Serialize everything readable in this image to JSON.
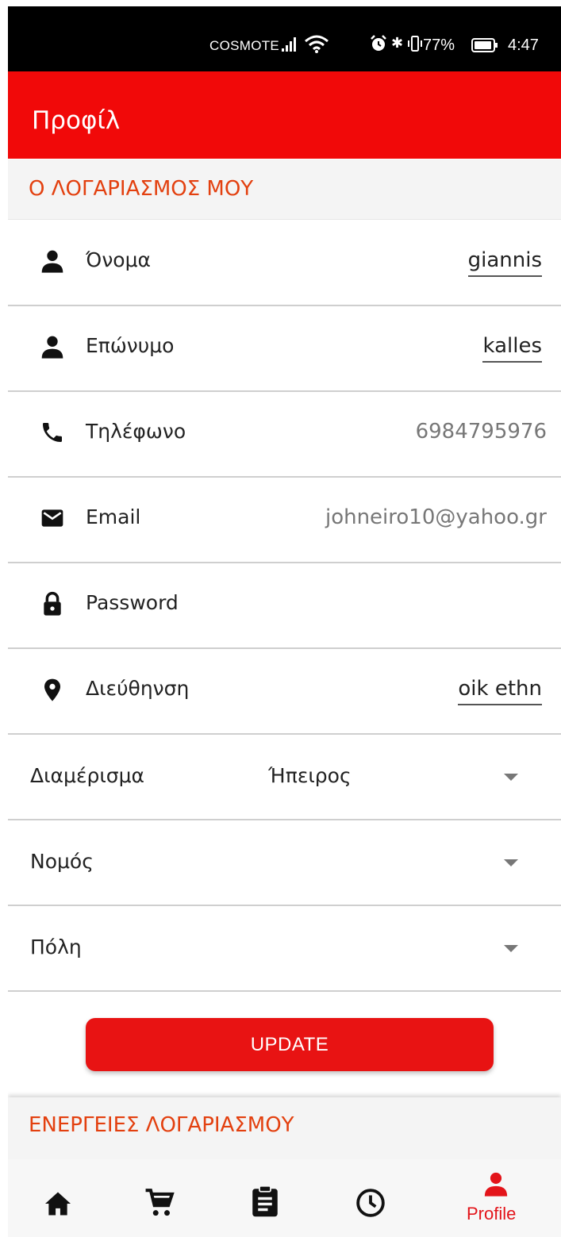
{
  "status_bar": {
    "carrier": "COSMOTE",
    "battery_percent": "77%",
    "time": "4:47",
    "icons": [
      "signal-icon",
      "wifi-icon",
      "alarm-icon",
      "bluetooth-icon",
      "vibrate-icon",
      "battery-icon"
    ]
  },
  "app_bar": {
    "title": "Προφίλ"
  },
  "colors": {
    "primary": "#f10909",
    "accent_text": "#e3400f",
    "button": "#e81313",
    "active_nav": "#e3141a"
  },
  "account_section": {
    "title": "Ο ΛΟΓΑΡΙΑΣΜΟΣ ΜΟΥ",
    "fields": [
      {
        "icon": "person-icon",
        "label": "Όνομα",
        "value": "giannis"
      },
      {
        "icon": "person-icon",
        "label": "Επώνυμο",
        "value": "kalles"
      },
      {
        "icon": "phone-icon",
        "label": "Τηλέφωνο",
        "value": "6984795976"
      },
      {
        "icon": "mail-icon",
        "label": "Email",
        "value": "johneiro10@yahoo.gr"
      },
      {
        "icon": "lock-icon",
        "label": "Password",
        "value": ""
      },
      {
        "icon": "location-pin-icon",
        "label": "Διεύθηνση",
        "value": "oik ethn"
      }
    ],
    "dropdowns": [
      {
        "label": "Διαμέρισμα",
        "value": "Ήπειρος"
      },
      {
        "label": "Νομός",
        "value": ""
      },
      {
        "label": "Πόλη",
        "value": ""
      }
    ],
    "update_label": "UPDATE"
  },
  "actions_section": {
    "title": "ΕΝΕΡΓΕΙΕΣ ΛΟΓΑΡΙΑΣΜΟΥ"
  },
  "bottom_nav": {
    "items": [
      {
        "icon": "home-icon",
        "label": ""
      },
      {
        "icon": "cart-icon",
        "label": ""
      },
      {
        "icon": "clipboard-icon",
        "label": ""
      },
      {
        "icon": "history-clock-icon",
        "label": ""
      },
      {
        "icon": "profile-icon",
        "label": "Profile",
        "active": true
      }
    ]
  }
}
